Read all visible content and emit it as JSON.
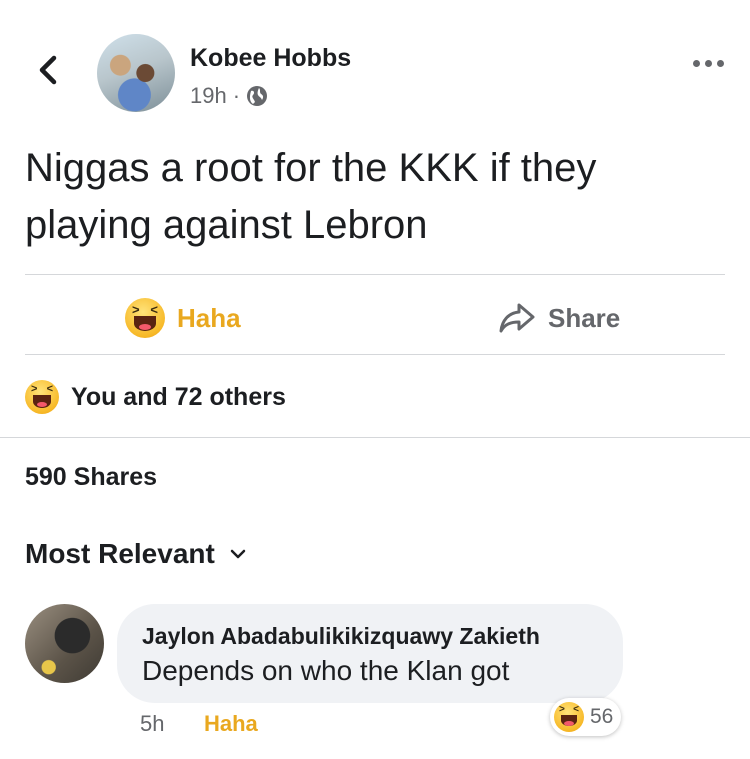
{
  "post": {
    "author": "Kobee Hobbs",
    "time": "19h",
    "separator": "·",
    "privacy_icon": "globe-icon",
    "text": "Niggas a root for the KKK if they playing against Lebron"
  },
  "actions": {
    "reaction_label": "Haha",
    "reaction_icon": "haha-emoji-icon",
    "share_label": "Share",
    "share_icon": "share-arrow-icon"
  },
  "reactions_summary": "You and 72 others",
  "shares_count": "590 Shares",
  "comments_sort": "Most Relevant",
  "comment": {
    "author": "Jaylon Abadabulikikizquawy Zakieth",
    "text": "Depends on who the Klan got",
    "time": "5h",
    "reaction_label": "Haha",
    "reaction_count": "56"
  },
  "colors": {
    "haha_accent": "#e9a81f",
    "secondary_text": "#65676b",
    "bubble_bg": "#f0f2f5"
  }
}
